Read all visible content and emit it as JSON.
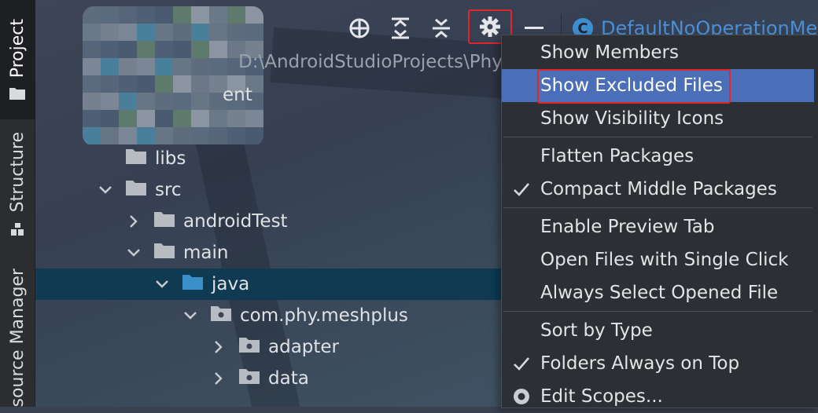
{
  "sidebar": {
    "tabs": [
      {
        "label": "Project",
        "active": true,
        "icon": "folder-icon"
      },
      {
        "label": "Structure",
        "active": false,
        "icon": "structure-icon"
      },
      {
        "label": "source Manager",
        "active": false
      }
    ]
  },
  "toolbar": {
    "buttons": [
      "locate-icon",
      "expand-all-icon",
      "collapse-all-icon",
      "gear-icon",
      "minimize-icon"
    ],
    "open_tab": {
      "badge": "C",
      "name": "DefaultNoOperationMes"
    }
  },
  "project_tree": {
    "path": "D:\\AndroidStudioProjects\\Phy",
    "partial_row": "ent",
    "rows": [
      {
        "label": "libs",
        "depth": 0,
        "expander": "none",
        "icon": "folder"
      },
      {
        "label": "src",
        "depth": 0,
        "expander": "expanded",
        "icon": "folder"
      },
      {
        "label": "androidTest",
        "depth": 1,
        "expander": "collapsed",
        "icon": "folder"
      },
      {
        "label": "main",
        "depth": 1,
        "expander": "expanded",
        "icon": "folder"
      },
      {
        "label": "java",
        "depth": 2,
        "expander": "expanded",
        "icon": "source-folder",
        "selected": true
      },
      {
        "label": "com.phy.meshplus",
        "depth": 3,
        "expander": "expanded",
        "icon": "package"
      },
      {
        "label": "adapter",
        "depth": 4,
        "expander": "collapsed",
        "icon": "package"
      },
      {
        "label": "data",
        "depth": 4,
        "expander": "collapsed",
        "icon": "package"
      }
    ]
  },
  "menu": {
    "groups": [
      [
        {
          "label": "Show Members",
          "check": false
        },
        {
          "label": "Show Excluded Files",
          "check": false,
          "highlighted": true
        },
        {
          "label": "Show Visibility Icons",
          "check": false
        }
      ],
      [
        {
          "label": "Flatten Packages",
          "check": false
        },
        {
          "label": "Compact Middle Packages",
          "check": true
        }
      ],
      [
        {
          "label": "Enable Preview Tab",
          "check": false
        },
        {
          "label": "Open Files with Single Click",
          "check": false
        },
        {
          "label": "Always Select Opened File",
          "check": false
        }
      ],
      [
        {
          "label": "Sort by Type",
          "check": false
        },
        {
          "label": "Folders Always on Top",
          "check": true
        },
        {
          "label": "Edit Scopes...",
          "check": false,
          "radio": true
        }
      ]
    ]
  },
  "colors": {
    "accent": "#4a6fb8",
    "selection": "#0f3a52",
    "highlight_border": "#e0262b",
    "link_blue": "#4a8fd8"
  }
}
